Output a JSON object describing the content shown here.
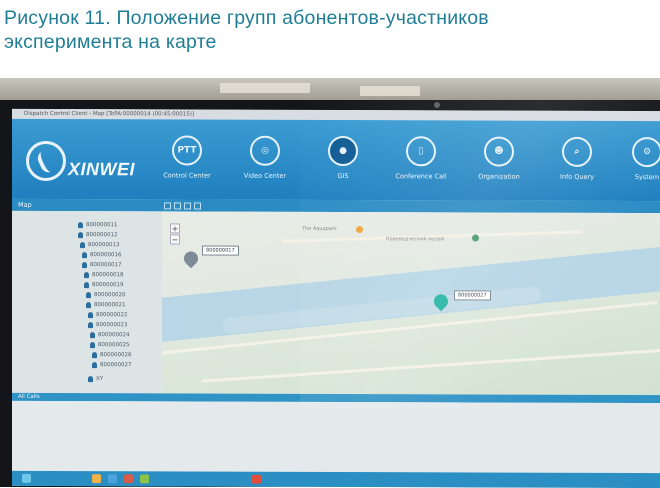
{
  "caption": {
    "line1": "Рисунок 11. Положение групп абонентов-участников",
    "line2": "эксперимента на карте"
  },
  "window": {
    "title": "Dispatch Control Client - Map [ToPA:00000014 (00:45:00015)]"
  },
  "app": {
    "logo": "XINWEI",
    "brand_color": "#1f7fbf",
    "nav": [
      {
        "label": "Control Center",
        "icon": "ptt-icon",
        "glyph": "PTT"
      },
      {
        "label": "Video Center",
        "icon": "video-signal-icon",
        "glyph": "◎"
      },
      {
        "label": "GIS",
        "icon": "globe-icon",
        "glyph": "●",
        "active": true
      },
      {
        "label": "Conference Call",
        "icon": "phone-icon",
        "glyph": "▯"
      },
      {
        "label": "Organization",
        "icon": "people-icon",
        "glyph": "☻"
      },
      {
        "label": "Info Query",
        "icon": "search-icon",
        "glyph": "⌕"
      },
      {
        "label": "System",
        "icon": "gear-icon",
        "glyph": "⚙"
      }
    ]
  },
  "left_panel": {
    "title": "Map",
    "items": [
      "800000011",
      "800000012",
      "800000013",
      "800000016",
      "800000017",
      "800000018",
      "800000019",
      "800000020",
      "800000021",
      "800000022",
      "800000023",
      "800000024",
      "800000025",
      "800000026",
      "800000027"
    ],
    "footer_item": "XY"
  },
  "map": {
    "markers": [
      {
        "label": "800000017",
        "color": "#7e8a95"
      },
      {
        "label": "800000027",
        "color": "#23b5a3"
      }
    ],
    "poi_labels": [
      "The Aquapark",
      "Краеведческий музей"
    ]
  },
  "lower_panel": {
    "title": "All Calls"
  }
}
